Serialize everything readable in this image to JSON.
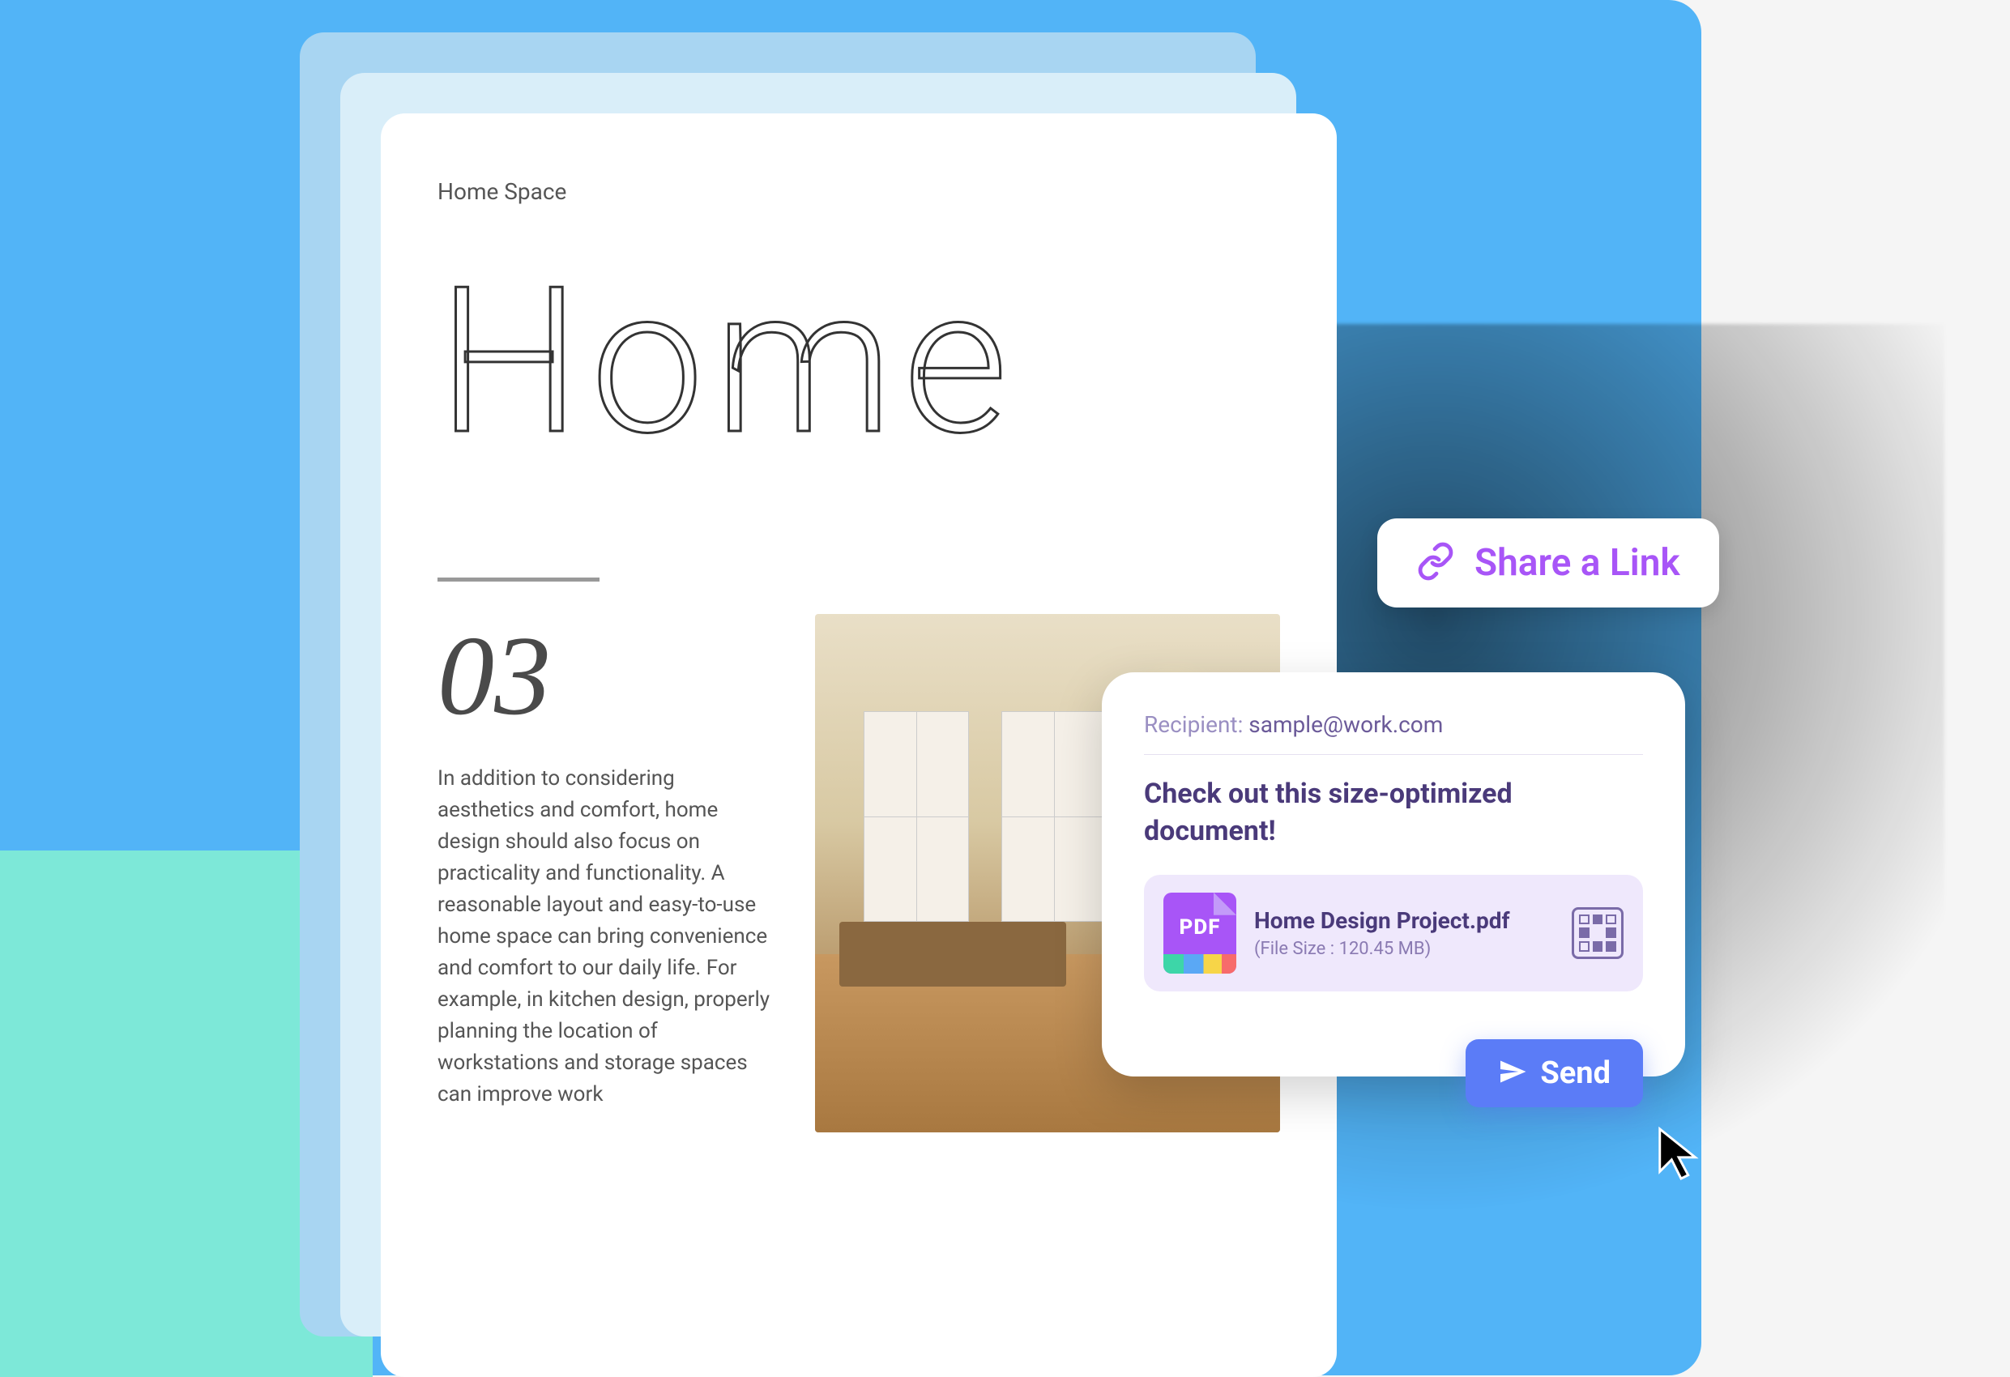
{
  "colors": {
    "bg_blue": "#52b4f7",
    "bg_teal": "#7de8d8",
    "accent_purple": "#a855f7",
    "accent_blue": "#5b7cf7",
    "text_purple_dark": "#4a3a7a"
  },
  "document": {
    "header": "Home Space",
    "title": "Home",
    "section_number": "03",
    "paragraph": "In addition to considering aesthetics and comfort, home design should also focus on practicality and functionality. A reasonable layout and easy-to-use home space can bring convenience and comfort to our daily life. For example, in kitchen design, properly planning the location of workstations and storage spaces can improve work"
  },
  "share_link_button": {
    "label": "Share a Link",
    "icon": "link-icon"
  },
  "share_panel": {
    "recipient_label": "Recipient: ",
    "recipient_value": "sample@work.com",
    "message": "Check out this size-optimized document!",
    "attachment": {
      "icon_label": "PDF",
      "filename": "Home Design Project.pdf",
      "filesize_text": "(File Size : 120.45 MB)"
    },
    "send_button": {
      "label": "Send",
      "icon": "paper-plane-icon"
    }
  }
}
